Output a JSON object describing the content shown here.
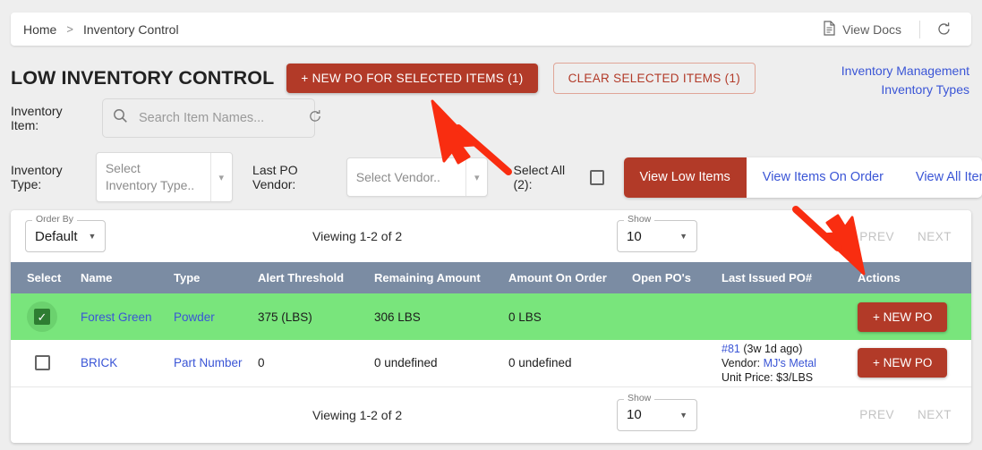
{
  "breadcrumb": {
    "home": "Home",
    "separator": ">",
    "current": "Inventory Control"
  },
  "topbar": {
    "view_docs": "View Docs",
    "refresh_icon": "refresh-icon",
    "docs_icon": "document-icon"
  },
  "header": {
    "title": "LOW INVENTORY CONTROL",
    "new_po_selected": "+ NEW PO FOR SELECTED ITEMS (1)",
    "clear_selected": "CLEAR SELECTED ITEMS (1)",
    "links": [
      "Inventory Management",
      "Inventory Types"
    ]
  },
  "filters": {
    "inventory_item_label": "Inventory Item:",
    "search_placeholder": "Search Item Names...",
    "search_value": "",
    "search_icon": "search-icon",
    "search_refresh_icon": "refresh-icon",
    "inventory_type_label": "Inventory Type:",
    "inventory_type_value": "Select Inventory Type..",
    "last_po_vendor_label": "Last PO Vendor:",
    "last_po_vendor_value": "Select Vendor..",
    "select_all_label": "Select All (2):",
    "select_all_checked": false,
    "tabs": [
      {
        "label": "View Low Items",
        "active": true
      },
      {
        "label": "View Items On Order",
        "active": false
      },
      {
        "label": "View All Items",
        "active": false
      }
    ]
  },
  "toolbar": {
    "order_by_legend": "Order By",
    "order_by_value": "Default",
    "viewing": "Viewing 1-2 of 2",
    "show_legend": "Show",
    "show_value": "10",
    "prev": "PREV",
    "next": "NEXT"
  },
  "footer": {
    "viewing": "Viewing 1-2 of 2",
    "show_legend": "Show",
    "show_value": "10",
    "prev": "PREV",
    "next": "NEXT"
  },
  "table": {
    "columns": [
      "Select",
      "Name",
      "Type",
      "Alert Threshold",
      "Remaining Amount",
      "Amount On Order",
      "Open PO's",
      "Last Issued PO#",
      "Actions"
    ],
    "rows": [
      {
        "selected": true,
        "name": "Forest Green",
        "type": "Powder",
        "alert_threshold": "375 (LBS)",
        "remaining_amount": "306 LBS",
        "amount_on_order": "0 LBS",
        "open_pos": "",
        "last_po_number": "",
        "last_po_age": "",
        "last_po_vendor_label": "",
        "last_po_vendor": "",
        "last_po_unit_price": "",
        "action_label": "+ NEW PO"
      },
      {
        "selected": false,
        "name": "BRICK",
        "type": "Part Number",
        "alert_threshold": "0",
        "remaining_amount": "0 undefined",
        "amount_on_order": "0 undefined",
        "open_pos": "",
        "last_po_number": "#81",
        "last_po_age": "(3w 1d ago)",
        "last_po_vendor_label": "Vendor:",
        "last_po_vendor": "MJ's Metal",
        "last_po_unit_price": "Unit Price: $3/LBS",
        "action_label": "+ NEW PO"
      }
    ]
  },
  "annotations": {
    "arrow_color": "#f92d10",
    "arrows": [
      "arrow-to-new-po-for-selected-items",
      "arrow-to-actions-column"
    ]
  },
  "colors": {
    "brand_red": "#b23a28",
    "link_blue": "#3a55d6",
    "table_header": "#7b8ca3",
    "selected_row_green": "#79e57c",
    "page_background": "#eeeeee"
  }
}
